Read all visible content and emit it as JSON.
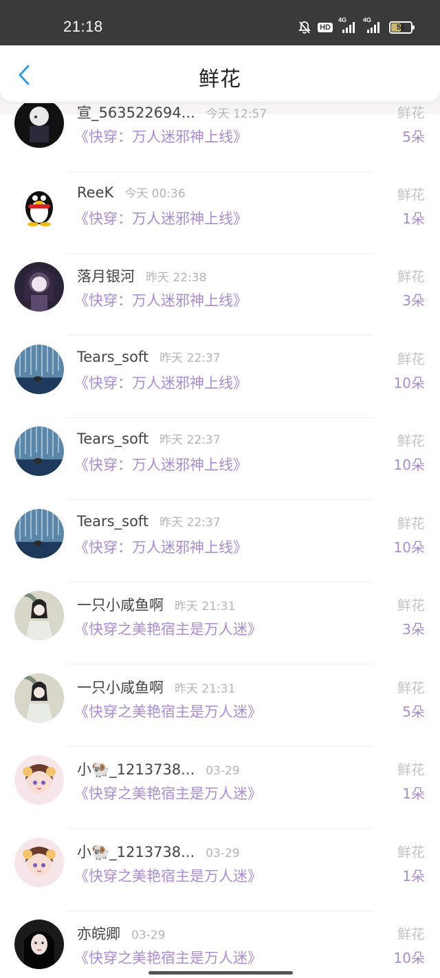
{
  "status_bar": {
    "time": "21:18",
    "hd_label": "HD",
    "net1": "4G",
    "net2": "4G",
    "battery": "51",
    "battery_level": 0.51
  },
  "header": {
    "title": "鲜花",
    "back_icon": "chevron-left-icon",
    "accent_color": "#2a9fe8"
  },
  "colors": {
    "book_title": "#a98bd6",
    "gift_count": "#a98bd6"
  },
  "records": [
    {
      "name": "宣_563522694...",
      "time": "今天 12:57",
      "book": "《快穿：万人迷邪神上线》",
      "gift": "鲜花",
      "count": "5朵"
    },
    {
      "name": "ReeK",
      "time": "今天 00:36",
      "book": "《快穿：万人迷邪神上线》",
      "gift": "鲜花",
      "count": "1朵"
    },
    {
      "name": "落月银河",
      "time": "昨天 22:38",
      "book": "《快穿：万人迷邪神上线》",
      "gift": "鲜花",
      "count": "3朵"
    },
    {
      "name": "Tears_soft",
      "time": "昨天 22:37",
      "book": "《快穿：万人迷邪神上线》",
      "gift": "鲜花",
      "count": "10朵"
    },
    {
      "name": "Tears_soft",
      "time": "昨天 22:37",
      "book": "《快穿：万人迷邪神上线》",
      "gift": "鲜花",
      "count": "10朵"
    },
    {
      "name": "Tears_soft",
      "time": "昨天 22:37",
      "book": "《快穿：万人迷邪神上线》",
      "gift": "鲜花",
      "count": "10朵"
    },
    {
      "name": "一只小咸鱼啊",
      "time": "昨天 21:31",
      "book": "《快穿之美艳宿主是万人迷》",
      "gift": "鲜花",
      "count": "3朵"
    },
    {
      "name": "一只小咸鱼啊",
      "time": "昨天 21:31",
      "book": "《快穿之美艳宿主是万人迷》",
      "gift": "鲜花",
      "count": "5朵"
    },
    {
      "name": "小🐏_1213738...",
      "time": "03-29",
      "book": "《快穿之美艳宿主是万人迷》",
      "gift": "鲜花",
      "count": "1朵"
    },
    {
      "name": "小🐏_1213738...",
      "time": "03-29",
      "book": "《快穿之美艳宿主是万人迷》",
      "gift": "鲜花",
      "count": "1朵"
    },
    {
      "name": "亦皖卿",
      "time": "03-29",
      "book": "《快穿之美艳宿主是万人迷》",
      "gift": "鲜花",
      "count": "10朵"
    }
  ]
}
